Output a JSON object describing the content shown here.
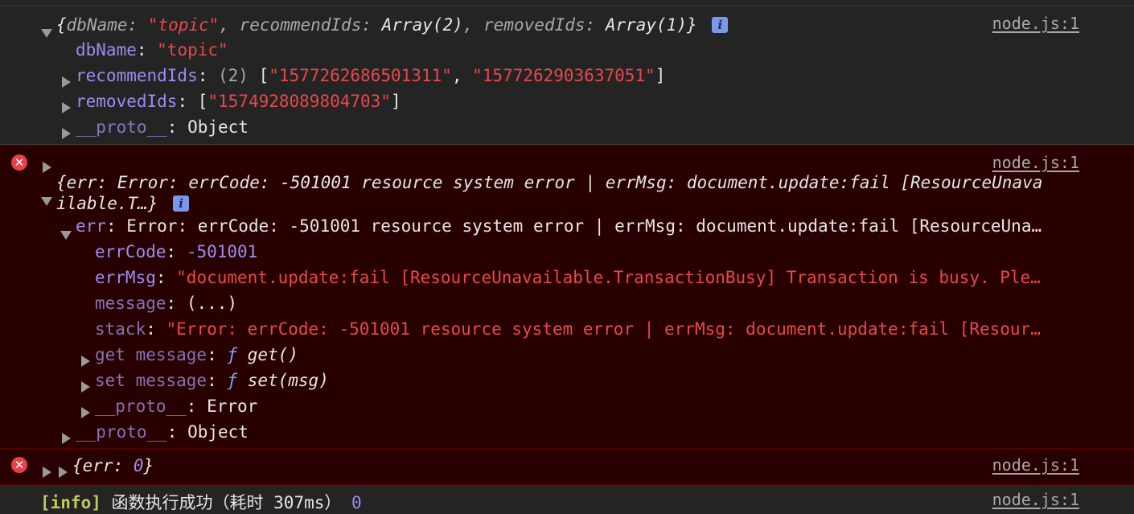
{
  "colors": {
    "background": "#242424",
    "error_background": "#290000",
    "string_red": "#e8484b",
    "key_purple": "#9c8cf0",
    "info_badge": "#7a97e8",
    "error_icon": "#e8404a"
  },
  "source_link": "node.js:1",
  "message1": {
    "summary": {
      "open_brace": "{",
      "k1": "dbName",
      "v1": "\"topic\"",
      "k2": "recommendIds",
      "v2": "Array(2)",
      "k3": "removedIds",
      "v3": "Array(1)",
      "close_brace": "}"
    },
    "info_icon": "i",
    "props": [
      {
        "key": "dbName",
        "value": "\"topic\""
      },
      {
        "key": "recommendIds",
        "count": "(2)",
        "items": [
          "\"1577262686501311\"",
          "\"1577262903637051\""
        ]
      },
      {
        "key": "removedIds",
        "items": [
          "\"1574928089804703\""
        ]
      },
      {
        "key": "__proto__",
        "value": "Object"
      }
    ]
  },
  "message2": {
    "summary_line1": "{err: Error: errCode: -501001 resource system error | errMsg: document.update:fail [ResourceUnava",
    "summary_line2": "ilable.T…}",
    "info_icon": "i",
    "err_key": "err",
    "err_value": "Error: errCode: -501001 resource system error | errMsg: document.update:fail [ResourceUna…",
    "errCode_key": "errCode",
    "errCode_value": "-501001",
    "errMsg_key": "errMsg",
    "errMsg_value": "\"document.update:fail [ResourceUnavailable.TransactionBusy] Transaction is busy. Ple…",
    "message_key": "message",
    "message_value": "(...)",
    "stack_key": "stack",
    "stack_value": "\"Error: errCode: -501001 resource system error | errMsg: document.update:fail [Resour…",
    "get_key": "get message",
    "get_value": "get()",
    "set_key": "set message",
    "set_value": "set(msg)",
    "proto_inner_key": "__proto__",
    "proto_inner_value": "Error",
    "proto_outer_key": "__proto__",
    "proto_outer_value": "Object",
    "fn_glyph": "ƒ"
  },
  "message3": {
    "summary_open": "{err: ",
    "summary_value": "0",
    "summary_close": "}"
  },
  "message4": {
    "label": "[info]",
    "text": "函数执行成功（耗时 307ms）",
    "value": "0"
  },
  "icons": {
    "error": "error-x-icon",
    "expand": "triangle-expand-icon",
    "collapse": "triangle-collapse-icon",
    "info": "info-icon"
  }
}
